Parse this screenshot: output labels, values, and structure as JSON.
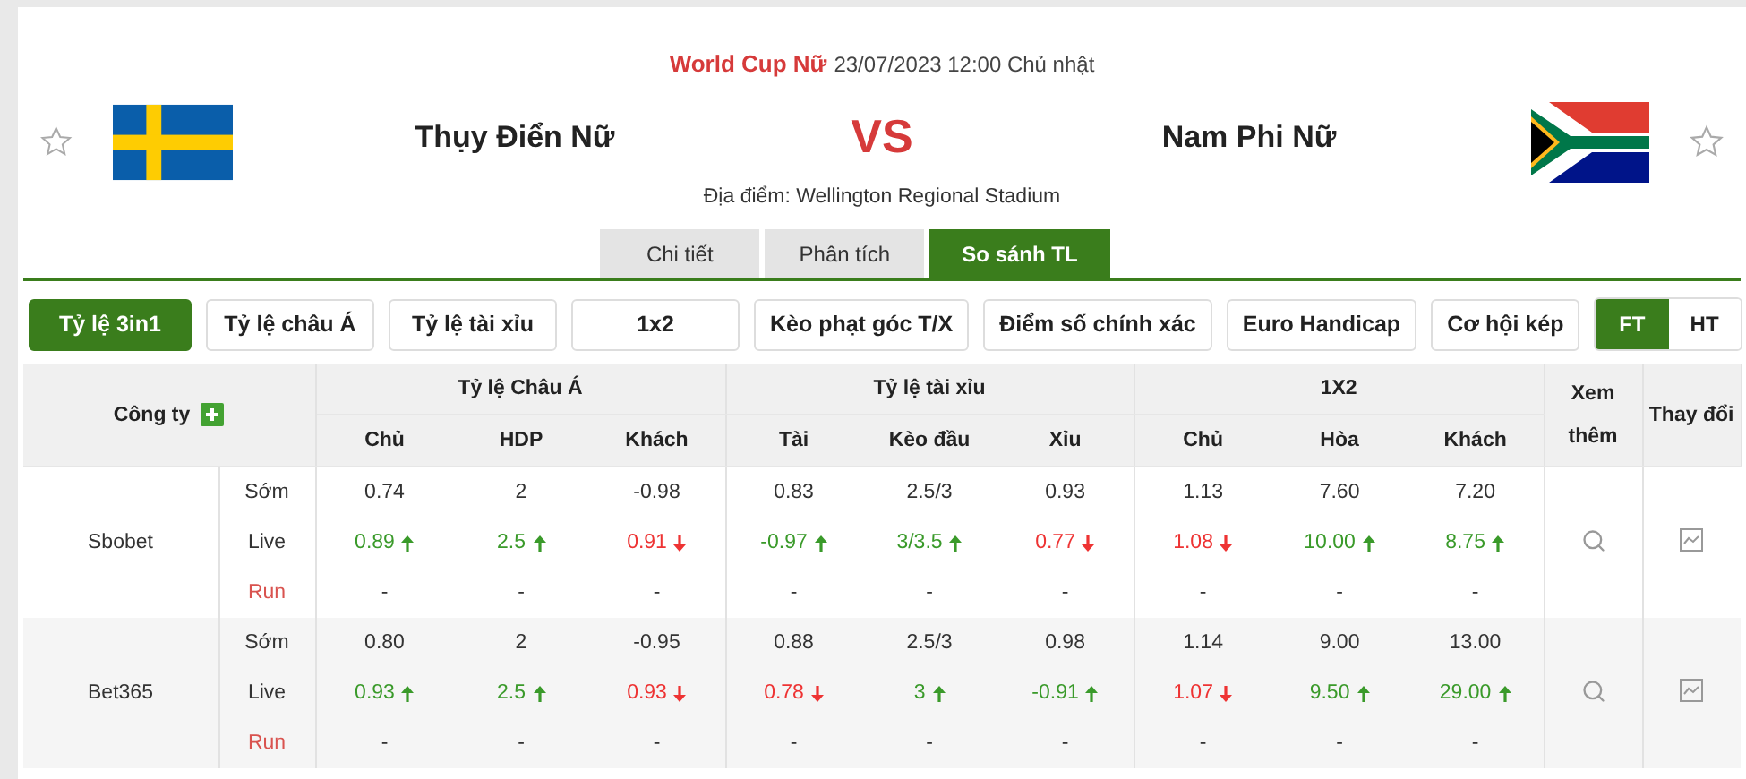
{
  "match": {
    "competition": "World Cup Nữ",
    "datetime": "23/07/2023 12:00 Chủ nhật",
    "home": "Thụy Điển Nữ",
    "vs": "VS",
    "away": "Nam Phi Nữ",
    "venue": "Địa điểm: Wellington Regional Stadium"
  },
  "tabs": [
    {
      "label": "Chi tiết",
      "selected": false
    },
    {
      "label": "Phân tích",
      "selected": false
    },
    {
      "label": "So sánh TL",
      "selected": true
    }
  ],
  "filters": [
    {
      "label": "Tỷ lệ 3in1",
      "selected": true
    },
    {
      "label": "Tỷ lệ châu Á",
      "selected": false
    },
    {
      "label": "Tỷ lệ tài xỉu",
      "selected": false
    },
    {
      "label": "1x2",
      "selected": false
    },
    {
      "label": "Kèo phạt góc T/X",
      "selected": false
    },
    {
      "label": "Điểm số chính xác",
      "selected": false
    },
    {
      "label": "Euro Handicap",
      "selected": false
    },
    {
      "label": "Cơ hội kép",
      "selected": false
    }
  ],
  "periods": [
    {
      "label": "FT",
      "selected": true
    },
    {
      "label": "HT",
      "selected": false
    }
  ],
  "table": {
    "company_heading": "Công ty",
    "more_heading": "Xem thêm",
    "change_heading": "Thay đổi",
    "groups": [
      {
        "label": "Tỷ lệ Châu Á",
        "columns": [
          "Chủ",
          "HDP",
          "Khách"
        ]
      },
      {
        "label": "Tỷ lệ tài xỉu",
        "columns": [
          "Tài",
          "Kèo đầu",
          "Xỉu"
        ]
      },
      {
        "label": "1X2",
        "columns": [
          "Chủ",
          "Hòa",
          "Khách"
        ]
      }
    ],
    "rows": [
      {
        "company": "Sbobet",
        "lines": [
          {
            "label": "Sớm",
            "kind": "early",
            "cells": [
              {
                "value": "0.74",
                "kind": "same"
              },
              {
                "value": "2",
                "kind": "same"
              },
              {
                "value": "-0.98",
                "kind": "same"
              },
              {
                "value": "0.83",
                "kind": "same"
              },
              {
                "value": "2.5/3",
                "kind": "same"
              },
              {
                "value": "0.93",
                "kind": "same"
              },
              {
                "value": "1.13",
                "kind": "same"
              },
              {
                "value": "7.60",
                "kind": "same"
              },
              {
                "value": "7.20",
                "kind": "same"
              }
            ]
          },
          {
            "label": "Live",
            "kind": "live",
            "cells": [
              {
                "value": "0.89",
                "kind": "up"
              },
              {
                "value": "2.5",
                "kind": "up"
              },
              {
                "value": "0.91",
                "kind": "down"
              },
              {
                "value": "-0.97",
                "kind": "up"
              },
              {
                "value": "3/3.5",
                "kind": "up"
              },
              {
                "value": "0.77",
                "kind": "down"
              },
              {
                "value": "1.08",
                "kind": "down"
              },
              {
                "value": "10.00",
                "kind": "up"
              },
              {
                "value": "8.75",
                "kind": "up"
              }
            ]
          },
          {
            "label": "Run",
            "kind": "run",
            "cells": [
              {
                "value": "-",
                "kind": "same"
              },
              {
                "value": "-",
                "kind": "same"
              },
              {
                "value": "-",
                "kind": "same"
              },
              {
                "value": "-",
                "kind": "same"
              },
              {
                "value": "-",
                "kind": "same"
              },
              {
                "value": "-",
                "kind": "same"
              },
              {
                "value": "-",
                "kind": "same"
              },
              {
                "value": "-",
                "kind": "same"
              },
              {
                "value": "-",
                "kind": "same"
              }
            ]
          }
        ]
      },
      {
        "company": "Bet365",
        "lines": [
          {
            "label": "Sớm",
            "kind": "early",
            "cells": [
              {
                "value": "0.80",
                "kind": "same"
              },
              {
                "value": "2",
                "kind": "same"
              },
              {
                "value": "-0.95",
                "kind": "same"
              },
              {
                "value": "0.88",
                "kind": "same"
              },
              {
                "value": "2.5/3",
                "kind": "same"
              },
              {
                "value": "0.98",
                "kind": "same"
              },
              {
                "value": "1.14",
                "kind": "same"
              },
              {
                "value": "9.00",
                "kind": "same"
              },
              {
                "value": "13.00",
                "kind": "same"
              }
            ]
          },
          {
            "label": "Live",
            "kind": "live",
            "cells": [
              {
                "value": "0.93",
                "kind": "up"
              },
              {
                "value": "2.5",
                "kind": "up"
              },
              {
                "value": "0.93",
                "kind": "down"
              },
              {
                "value": "0.78",
                "kind": "down"
              },
              {
                "value": "3",
                "kind": "up"
              },
              {
                "value": "-0.91",
                "kind": "up"
              },
              {
                "value": "1.07",
                "kind": "down"
              },
              {
                "value": "9.50",
                "kind": "up"
              },
              {
                "value": "29.00",
                "kind": "up"
              }
            ]
          },
          {
            "label": "Run",
            "kind": "run",
            "cells": [
              {
                "value": "-",
                "kind": "same"
              },
              {
                "value": "-",
                "kind": "same"
              },
              {
                "value": "-",
                "kind": "same"
              },
              {
                "value": "-",
                "kind": "same"
              },
              {
                "value": "-",
                "kind": "same"
              },
              {
                "value": "-",
                "kind": "same"
              },
              {
                "value": "-",
                "kind": "same"
              },
              {
                "value": "-",
                "kind": "same"
              },
              {
                "value": "-",
                "kind": "same"
              }
            ]
          }
        ]
      }
    ]
  }
}
